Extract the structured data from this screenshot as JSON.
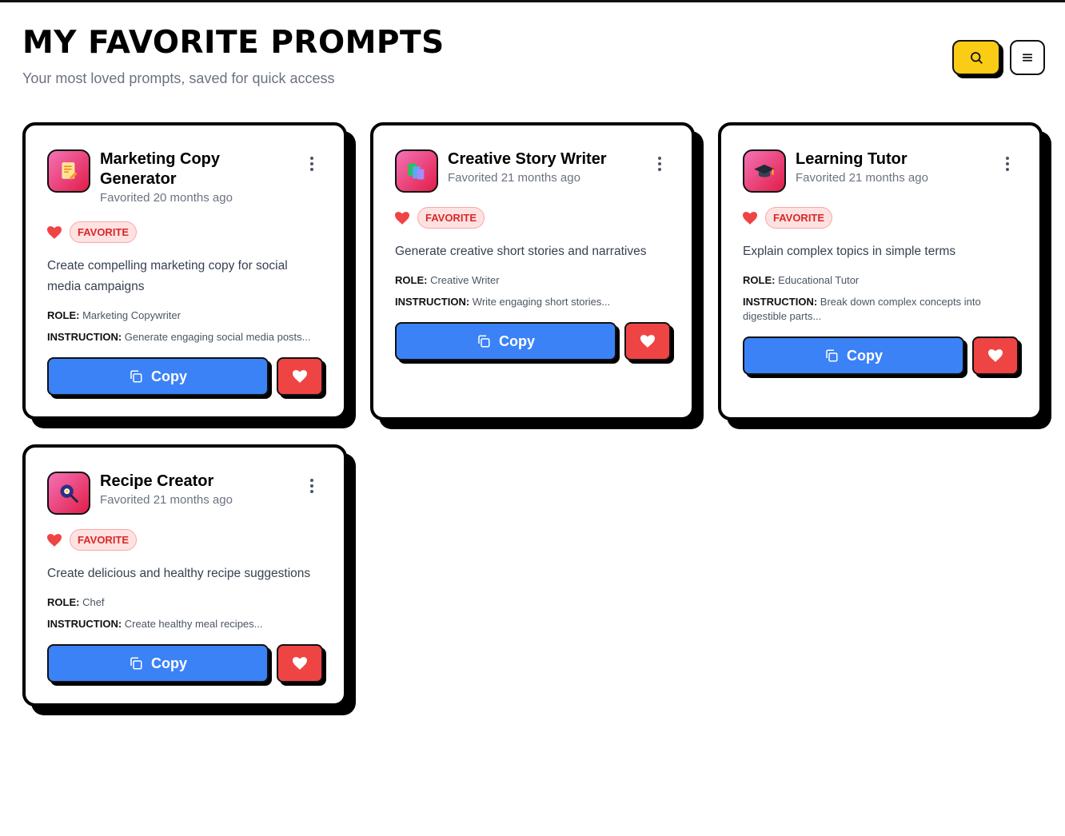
{
  "page": {
    "title": "MY FAVORITE PROMPTS",
    "subtitle": "Your most loved prompts, saved for quick access"
  },
  "header_actions": {
    "search_icon": "search-icon",
    "menu_icon": "menu-icon"
  },
  "colors": {
    "accent_yellow": "#facc15",
    "copy_blue": "#3b82f6",
    "heart_red": "#ef4444",
    "badge_red": "#dc2626"
  },
  "cards": [
    {
      "title": "Marketing Copy Generator",
      "favorited": "Favorited 20 months ago",
      "badge": "FAVORITE",
      "description": "Create compelling marketing copy for social media campaigns",
      "role_label": "ROLE:",
      "role": "Marketing Copywriter",
      "instruction_label": "INSTRUCTION:",
      "instruction": "Generate engaging social media posts...",
      "copy_label": "Copy",
      "icon": "memo-icon"
    },
    {
      "title": "Creative Story Writer",
      "favorited": "Favorited 21 months ago",
      "badge": "FAVORITE",
      "description": "Generate creative short stories and narratives",
      "role_label": "ROLE:",
      "role": "Creative Writer",
      "instruction_label": "INSTRUCTION:",
      "instruction": "Write engaging short stories...",
      "copy_label": "Copy",
      "icon": "books-icon"
    },
    {
      "title": "Learning Tutor",
      "favorited": "Favorited 21 months ago",
      "badge": "FAVORITE",
      "description": "Explain complex topics in simple terms",
      "role_label": "ROLE:",
      "role": "Educational Tutor",
      "instruction_label": "INSTRUCTION:",
      "instruction": "Break down complex concepts into digestible parts...",
      "copy_label": "Copy",
      "icon": "graduation-cap-icon"
    },
    {
      "title": "Recipe Creator",
      "favorited": "Favorited 21 months ago",
      "badge": "FAVORITE",
      "description": "Create delicious and healthy recipe suggestions",
      "role_label": "ROLE:",
      "role": "Chef",
      "instruction_label": "INSTRUCTION:",
      "instruction": "Create healthy meal recipes...",
      "copy_label": "Copy",
      "icon": "frying-pan-icon"
    }
  ]
}
